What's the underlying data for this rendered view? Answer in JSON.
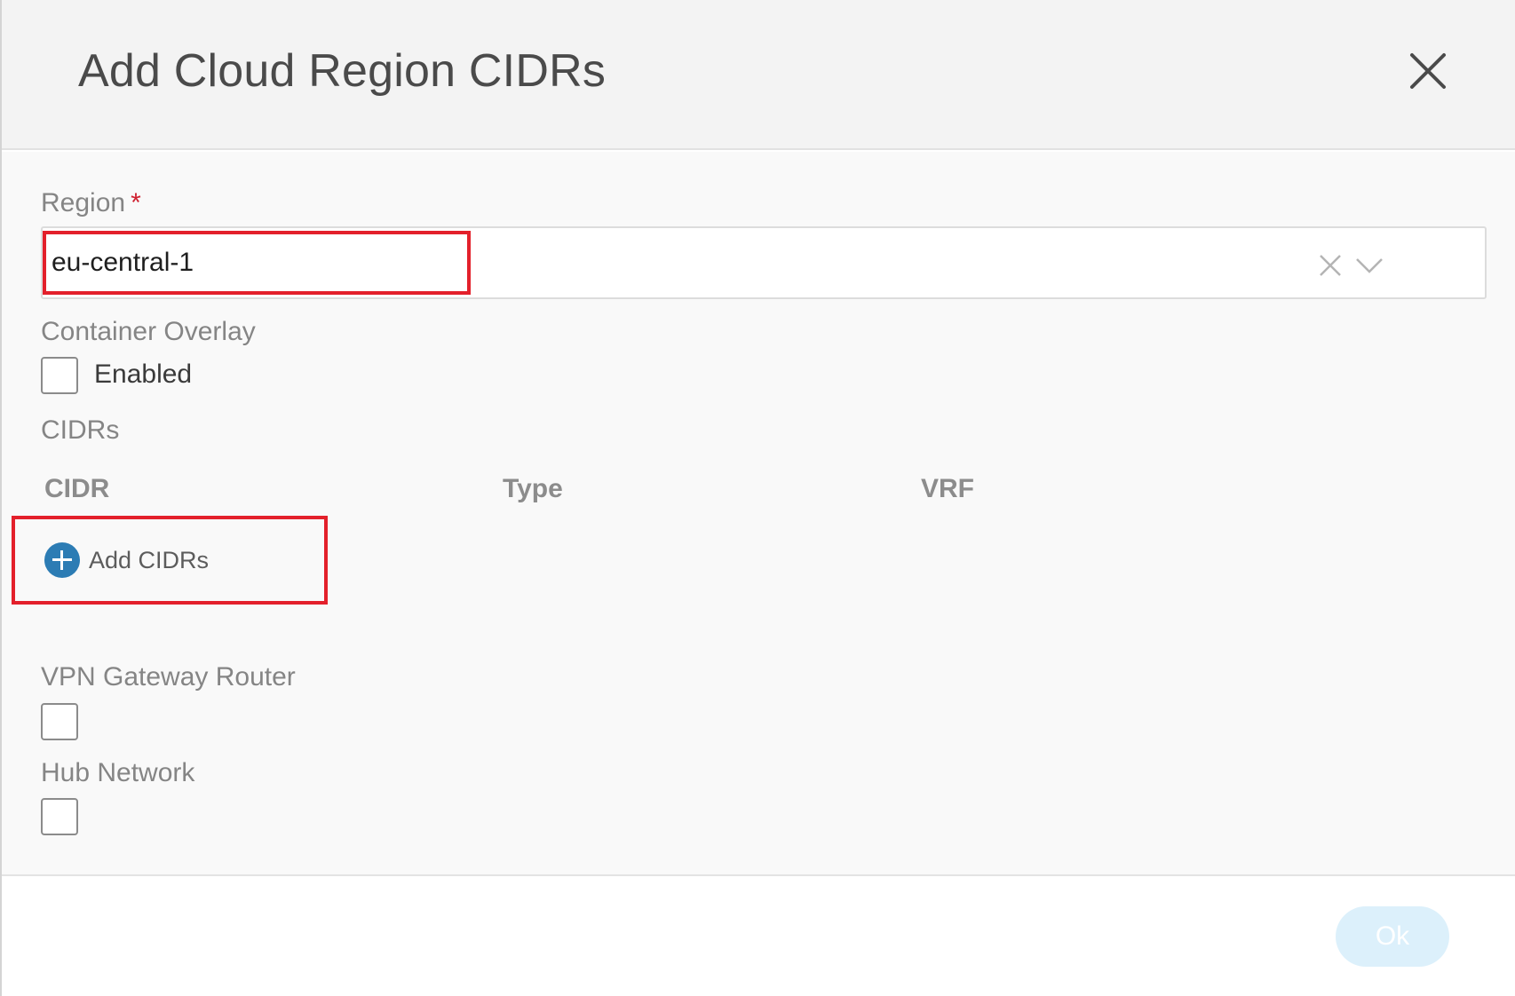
{
  "dialog": {
    "title": "Add Cloud Region CIDRs",
    "close_icon": "close-icon"
  },
  "region": {
    "label": "Region",
    "required_marker": "*",
    "value": "eu-central-1",
    "clear_icon": "clear-x-icon",
    "dropdown_icon": "chevron-down-icon"
  },
  "container_overlay": {
    "label": "Container Overlay",
    "checkbox_label": "Enabled",
    "checked": false
  },
  "cidrs": {
    "label": "CIDRs",
    "columns": [
      "CIDR",
      "Type",
      "VRF"
    ],
    "rows": [],
    "add_label": "Add CIDRs",
    "add_icon": "plus-circle-icon"
  },
  "vpn_gateway_router": {
    "label": "VPN Gateway Router",
    "checked": false
  },
  "hub_network": {
    "label": "Hub Network",
    "checked": false
  },
  "footer": {
    "ok_label": "Ok"
  },
  "colors": {
    "accent": "#2c7cb4",
    "highlight": "#e3202b",
    "required": "#cf2030",
    "ok_disabled": "#dcf0fb"
  }
}
